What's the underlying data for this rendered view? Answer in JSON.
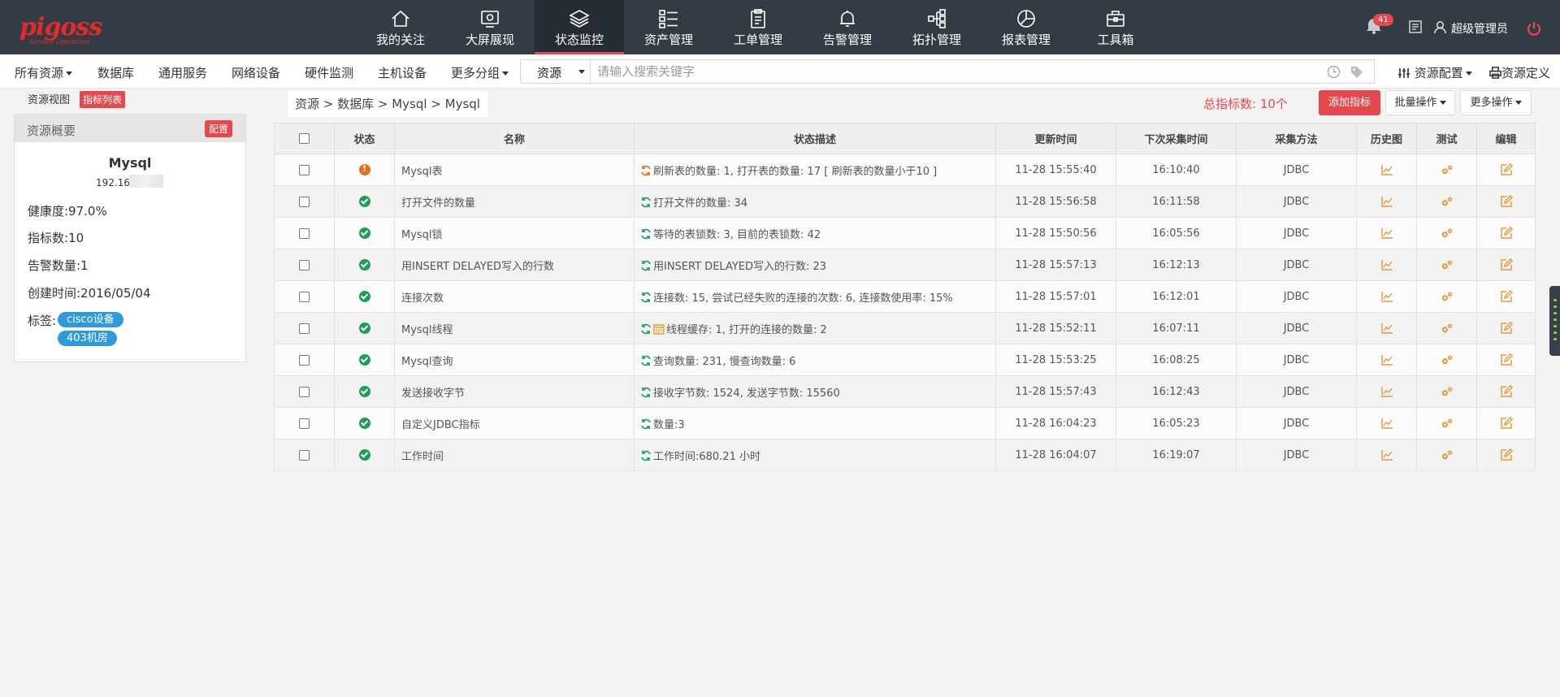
{
  "app": {
    "logo_text": "pigoss",
    "logo_sub": "Service Operation"
  },
  "topnav": {
    "items": [
      {
        "label": "我的关注",
        "icon": "home-icon"
      },
      {
        "label": "大屏展现",
        "icon": "screen-icon"
      },
      {
        "label": "状态监控",
        "icon": "layers-icon",
        "active": true
      },
      {
        "label": "资产管理",
        "icon": "list-icon"
      },
      {
        "label": "工单管理",
        "icon": "clipboard-icon"
      },
      {
        "label": "告警管理",
        "icon": "bell-icon"
      },
      {
        "label": "拓扑管理",
        "icon": "topology-icon"
      },
      {
        "label": "报表管理",
        "icon": "pie-chart-icon"
      },
      {
        "label": "工具箱",
        "icon": "toolbox-icon"
      }
    ],
    "alert_count": "41",
    "user_name": "超级管理员"
  },
  "subbar": {
    "all_resources": "所有资源",
    "database": "数据库",
    "general_service": "通用服务",
    "network_device": "网络设备",
    "hardware_monitor": "硬件监测",
    "host_device": "主机设备",
    "more_groups": "更多分组",
    "search_scope": "资源",
    "search_placeholder": "请输入搜索关键字",
    "resource_config": "资源配置",
    "resource_define": "资源定义"
  },
  "left_panel": {
    "tab_view": "资源视图",
    "tab_list": "指标列表",
    "overview_title": "资源概要",
    "config_label": "配置",
    "resource_name": "Mysql",
    "ip_prefix": "192.16",
    "health": "健康度:97.0%",
    "metric_count": "指标数:10",
    "alarm_count": "告警数量:1",
    "created": "创建时间:2016/05/04",
    "tags_label": "标签:",
    "tags": [
      "cisco设备",
      "403机房"
    ]
  },
  "main": {
    "breadcrumb": "资源 > 数据库 > Mysql > Mysql",
    "total_metrics": "总指标数: 10个",
    "add_metric": "添加指标",
    "batch_ops": "批量操作",
    "more_ops": "更多操作"
  },
  "table": {
    "columns": [
      "状态",
      "名称",
      "状态描述",
      "更新时间",
      "下次采集时间",
      "采集方法",
      "历史图",
      "测试",
      "编辑"
    ],
    "rows": [
      {
        "status": "warn",
        "name": "Mysql表",
        "desc": "刷新表的数量: 1, 打开表的数量: 17 [ 刷新表的数量小于10 ]",
        "updated": "11-28 15:55:40",
        "next": "16:10:40",
        "method": "JDBC"
      },
      {
        "status": "ok",
        "name": "打开文件的数量",
        "desc": "打开文件的数量: 34",
        "updated": "11-28 15:56:58",
        "next": "16:11:58",
        "method": "JDBC"
      },
      {
        "status": "ok",
        "name": "Mysql锁",
        "desc": "等待的表锁数: 3, 目前的表锁数: 42",
        "updated": "11-28 15:50:56",
        "next": "16:05:56",
        "method": "JDBC"
      },
      {
        "status": "ok",
        "name": "用INSERT DELAYED写入的行数",
        "desc": "用INSERT DELAYED写入的行数: 23",
        "updated": "11-28 15:57:13",
        "next": "16:12:13",
        "method": "JDBC"
      },
      {
        "status": "ok",
        "name": "连接次数",
        "desc": "连接数: 15, 尝试已经失败的连接的次数: 6, 连接数使用率: 15%",
        "updated": "11-28 15:57:01",
        "next": "16:12:01",
        "method": "JDBC"
      },
      {
        "status": "ok",
        "name": "Mysql线程",
        "desc": "线程缓存: 1, 打开的连接的数量: 2",
        "updated": "11-28 15:52:11",
        "next": "16:07:11",
        "method": "JDBC",
        "calendar": true
      },
      {
        "status": "ok",
        "name": "Mysql查询",
        "desc": "查询数量: 231, 慢查询数量: 6",
        "updated": "11-28 15:53:25",
        "next": "16:08:25",
        "method": "JDBC"
      },
      {
        "status": "ok",
        "name": "发送接收字节",
        "desc": "接收字节数: 1524, 发送字节数: 15560",
        "updated": "11-28 15:57:43",
        "next": "16:12:43",
        "method": "JDBC"
      },
      {
        "status": "ok",
        "name": "自定义JDBC指标",
        "desc": "数量:3",
        "updated": "11-28 16:04:23",
        "next": "16:05:23",
        "method": "JDBC"
      },
      {
        "status": "ok",
        "name": "工作时间",
        "desc": "工作时间:680.21 小时",
        "updated": "11-28 16:04:07",
        "next": "16:19:07",
        "method": "JDBC"
      }
    ]
  },
  "colors": {
    "nav_bg": "#333b45",
    "accent": "#e5484d",
    "ok": "#24a464",
    "warn": "#e0731e",
    "tag": "#2d9ad9"
  }
}
